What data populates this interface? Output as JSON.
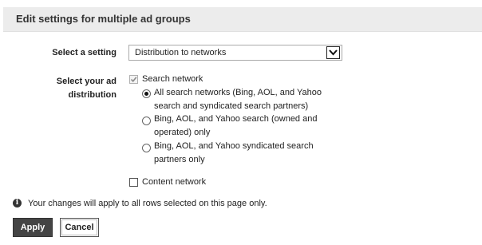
{
  "header": {
    "title": "Edit settings for multiple ad groups"
  },
  "setting": {
    "label": "Select a setting",
    "selected_value": "Distribution to networks"
  },
  "distribution": {
    "label_line1": "Select your ad",
    "label_line2": "distribution",
    "search_network": {
      "label": "Search network",
      "checked": true,
      "disabled": true
    },
    "options": [
      {
        "line1": "All search networks (Bing, AOL, and Yahoo",
        "line2": "search and syndicated search partners)",
        "selected": true
      },
      {
        "line1": "Bing, AOL, and Yahoo search (owned and",
        "line2": "operated) only",
        "selected": false
      },
      {
        "line1": "Bing, AOL, and Yahoo syndicated search",
        "line2": "partners only",
        "selected": false
      }
    ],
    "content_network": {
      "label": "Content network",
      "checked": false
    }
  },
  "info": {
    "icon": "info-icon",
    "text": "Your changes will apply to all rows selected on this page only."
  },
  "buttons": {
    "apply": "Apply",
    "cancel": "Cancel"
  }
}
